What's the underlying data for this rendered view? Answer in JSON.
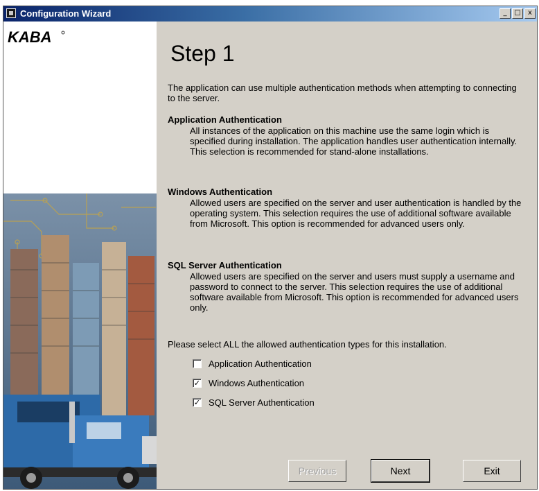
{
  "window": {
    "title": "Configuration Wizard",
    "min_glyph": "_",
    "max_glyph": "□",
    "close_glyph": "x"
  },
  "brand": {
    "logo_text": "KABA"
  },
  "step": {
    "title": "Step 1"
  },
  "intro": "The application can use multiple authentication methods when attempting to connecting to the server.",
  "sections": [
    {
      "title": "Application Authentication",
      "body": "All instances of the application on this machine use the same login which is specified during installation. The application handles user authentication internally. This selection is recommended for stand-alone installations."
    },
    {
      "title": "Windows Authentication",
      "body": "Allowed users are specified on the server and user authentication is handled by the operating system. This selection requires the use of additional software available from Microsoft.  This option is recommended for advanced users only."
    },
    {
      "title": "SQL Server Authentication",
      "body": "Allowed users are specified on the server and users must supply a username and password to connect to the server. This selection requires the use of additional software available from Microsoft.  This option is recommended for advanced users only."
    }
  ],
  "prompt": "Please select ALL the allowed authentication types for this installation.",
  "options": [
    {
      "label": "Application Authentication",
      "checked": false,
      "mark": ""
    },
    {
      "label": "Windows Authentication",
      "checked": true,
      "mark": "✓"
    },
    {
      "label": "SQL Server Authentication",
      "checked": true,
      "mark": "✓"
    }
  ],
  "buttons": {
    "previous": "Previous",
    "next": "Next",
    "exit": "Exit"
  }
}
